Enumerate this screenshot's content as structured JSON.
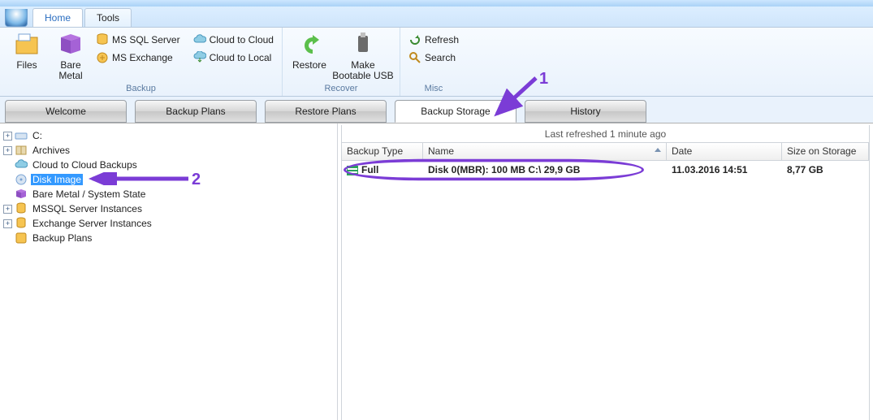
{
  "tabs": {
    "home": "Home",
    "tools": "Tools"
  },
  "ribbon": {
    "files": "Files",
    "bare_metal": "Bare\nMetal",
    "mssql": "MS SQL Server",
    "exchange": "MS Exchange",
    "cloud2cloud": "Cloud to Cloud",
    "cloud2local": "Cloud to Local",
    "restore": "Restore",
    "bootable": "Make\nBootable USB",
    "refresh": "Refresh",
    "search": "Search",
    "grp_backup": "Backup",
    "grp_recover": "Recover",
    "grp_misc": "Misc"
  },
  "nav": {
    "welcome": "Welcome",
    "backup_plans": "Backup Plans",
    "restore_plans": "Restore Plans",
    "backup_storage": "Backup Storage",
    "history": "History"
  },
  "tree": {
    "c": "C:",
    "archives": "Archives",
    "cloud_backups": "Cloud to Cloud Backups",
    "disk_image": "Disk Image",
    "bare_metal": "Bare Metal / System State",
    "mssql_inst": "MSSQL Server Instances",
    "exch_inst": "Exchange Server Instances",
    "backup_plans": "Backup Plans"
  },
  "grid": {
    "last_refreshed": "Last refreshed 1 minute ago",
    "hdr_type": "Backup Type",
    "hdr_name": "Name",
    "hdr_date": "Date",
    "hdr_size": "Size on Storage",
    "row": {
      "type": "Full",
      "name": "Disk 0(MBR):  100 MB   C:\\ 29,9 GB",
      "date": "11.03.2016 14:51",
      "size": "8,77 GB"
    }
  },
  "annot": {
    "n1": "1",
    "n2": "2"
  }
}
